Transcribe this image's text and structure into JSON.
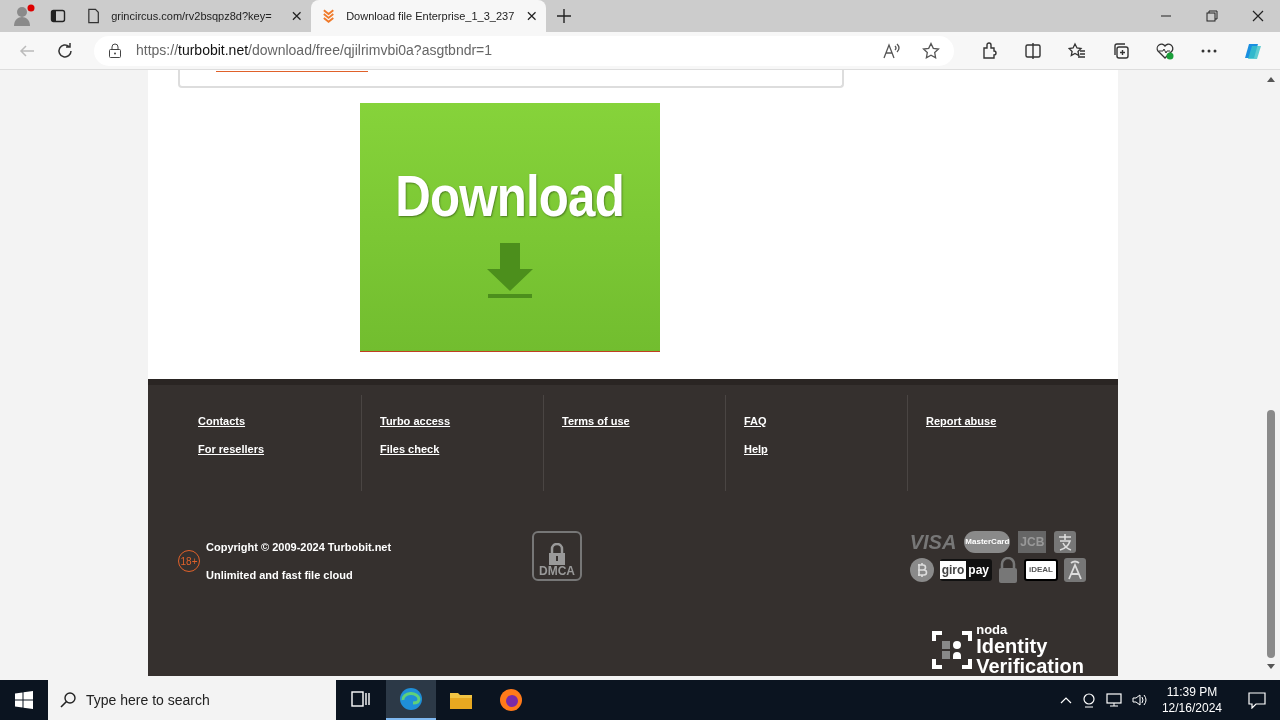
{
  "browser": {
    "tabs": [
      {
        "title": "grincircus.com/rv2bsqpz8d?key=",
        "selected": false,
        "kind": "page"
      },
      {
        "title": "Download file Enterprise_1_3_237",
        "selected": true,
        "kind": "site"
      }
    ],
    "url": {
      "prefix": "https://",
      "host": "turbobit.net",
      "path": "/download/free/qjilrimvbi0a?asgtbndr=1"
    }
  },
  "download_button": {
    "label": "Download"
  },
  "footer": {
    "columns": [
      [
        "Contacts",
        "For resellers"
      ],
      [
        "Turbo access",
        "Files check"
      ],
      [
        "Terms of use"
      ],
      [
        "FAQ",
        "Help"
      ],
      [
        "Report abuse"
      ]
    ],
    "age_badge": "18+",
    "copyright": "Copyright © 2009-2024 Turbobit.net",
    "tagline": "Unlimited and fast file cloud",
    "dmca": "DMCA",
    "payments": [
      {
        "kind": "visa",
        "label": "VISA"
      },
      {
        "kind": "mastercard",
        "label": "MasterCard"
      },
      {
        "kind": "jcb",
        "label": "JCB"
      },
      {
        "kind": "alipay"
      },
      {
        "kind": "bitcoin"
      },
      {
        "kind": "giropay",
        "label": "giro",
        "label2": "pay"
      },
      {
        "kind": "lock"
      },
      {
        "kind": "ideal",
        "label": "iDEAL"
      },
      {
        "kind": "a"
      }
    ],
    "verification": {
      "brand": "noda",
      "line1": "Identity",
      "line2": "Verification"
    }
  },
  "taskbar": {
    "search_placeholder": "Type here to search",
    "time": "11:39 PM",
    "date": "12/16/2024"
  }
}
